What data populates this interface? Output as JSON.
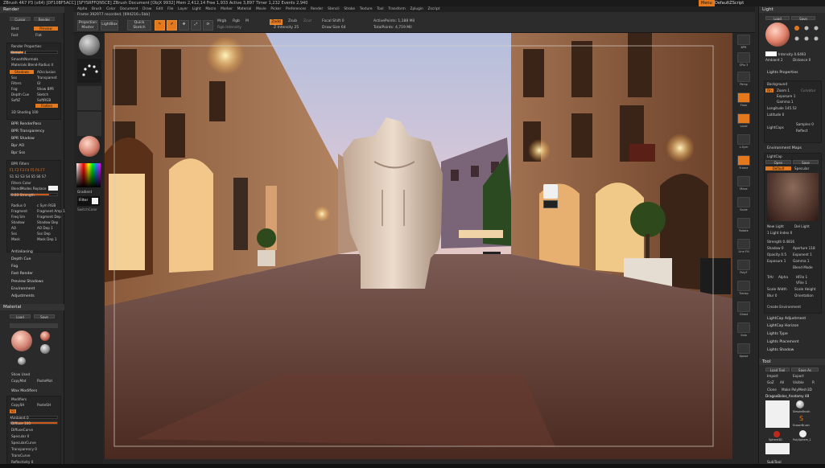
{
  "title_bar": {
    "app_info": "ZBrush 4R7 P3 (x64) [DF10BF5ACC] [SFYSRFFQN5CE]    ZBrush Document    [ObjX 9932] Mem 2,412,14  Free 1,933  Active 3,897  Timer 1,232  Events 2,940",
    "menu_label": "Menu",
    "script_label": "DefaultZScript"
  },
  "menubar": [
    "Alpha",
    "Brush",
    "Color",
    "Document",
    "Draw",
    "Edit",
    "File",
    "Layer",
    "Light",
    "Macro",
    "Marker",
    "Material",
    "Movie",
    "Picker",
    "Preferences",
    "Render",
    "Stencil",
    "Stroke",
    "Texture",
    "Tool",
    "Transform",
    "Zplugin",
    "Zscript"
  ],
  "toolbar": {
    "frame_info": "Frame 392977 recorded. [694216=5bb]",
    "projection_master": "Projection Master",
    "lightbox": "LightBox",
    "quick_sketch": "Quick Sketch",
    "edit": "Edit",
    "draw": "Draw",
    "move": "Move",
    "scale": "Scale",
    "rotate": "Rotate",
    "mrgb": "Mrgb",
    "rgb": "Rgb",
    "m": "M",
    "zadd": "Zadd",
    "zsub": "Zsub",
    "zcut": "Zcut",
    "rgb_intensity": "Rgb Intensity",
    "z_intensity": "Z Intensity 25",
    "focal_shift": "Focal Shift 0",
    "draw_size": "Draw Size 64",
    "active_points": "ActivePoints: 1,188 Mil",
    "total_points": "TotalPoints: 4,719 Mil"
  },
  "left_panel": {
    "render_title": "Render",
    "cursor": "Cursor",
    "render_btn": "Render",
    "best": "Best",
    "preview": "Preview",
    "fast": "Fast",
    "flat": "Flat",
    "render_properties": "Render Properties",
    "details": "Details 4",
    "smooth_normals": "SmoothNormals",
    "materials_blend_radius": "Materials Blend-Radius 4",
    "shadows": "Shadows",
    "ambient_occlusion": "AOcclusion",
    "sss": "Sss",
    "transparent": "Transparent",
    "gi": "GI",
    "bpr_filters_lbl": "Filters",
    "sketch": "Sketch",
    "fog": "Fog",
    "show_bpr": "Show BPR",
    "depth_cue": "Depth Cue",
    "softz": "SoftZ",
    "softrgb": "SoftRGB",
    "flatten": "Flatten",
    "ss_shading": "3D Shading 100",
    "bpr_renderpass": "BPR RenderPass",
    "bpr_transparency": "BPR Transparency",
    "bpr_shadow": "BPR Shadow",
    "bpr_ao": "Bpr AO",
    "bpr_sss": "Bpr Sss",
    "bpr_filters": "BPR Filters",
    "filter_color": "Filters Color",
    "blend_modes": "BlendModes Replace",
    "strength": "0.83  Strength",
    "radius": "Radius 0",
    "c_sym": "c Sym RGB",
    "fragment": "Fragment",
    "fragment_amp": "Fragment Amp 1",
    "freq_sm": "Freq Sm",
    "fragment_dep": "Fragment Dep",
    "shadow": "Shadow",
    "shadow_dep": "Shadow Dep",
    "ao": "AO",
    "ao_dep": "AO Dep 1",
    "sss2": "Sss",
    "sss_dep": "Sss Dep",
    "mask": "Mask",
    "mask_dep": "Mask Dep 1",
    "antialiasing": "Antialiasing",
    "depth_cue2": "Depth Cue",
    "fog2": "Fog",
    "fast_render": "Fast Render",
    "preview_shadows": "Preview Shadows",
    "environment": "Environment",
    "adjustments": "Adjustments",
    "material_title": "Material",
    "load": "Load",
    "save": "Save",
    "show_used": "Show Used",
    "copymat": "CopyMat",
    "pastemat": "PasteMat",
    "wax_modifiers": "Wax Modifiers",
    "modifiers": "Modifiers",
    "copysh": "CopySH",
    "pastesh": "PasteSH",
    "ambient": "Ambient 0",
    "diffuse": "Diffuse 100",
    "diffuse_curve": "DiffuseCurve",
    "specular": "Specular 0",
    "specular_curve": "SpecularCurve",
    "transparency": "Transparency 0",
    "transcurve": "TransCurve",
    "reflectivity": "Reflectivity 0",
    "colorize_diffuse": "ColorizeDiffuse",
    "colorize_specular": "ColorizeSpecular",
    "gradient": "Gradient",
    "switch_color": "SwitchColor"
  },
  "tray": {
    "filter": "Filter",
    "gradient": "Gradient",
    "switch_color": "SwitchColor"
  },
  "dock": [
    "BPR",
    "SPix 3",
    "Persp",
    "Floor",
    "Local",
    "L.Sym",
    "Frame",
    "Move",
    "Scale",
    "Rotate",
    "Line Fill",
    "PolyF",
    "Transp",
    "Ghost",
    "Solo",
    "Xpose"
  ],
  "right_panel": {
    "light_title": "Light",
    "load": "Load",
    "save": "Save",
    "intensity": "Intensity 0.6493",
    "ambient": "Ambient 2",
    "distance": "Distance 0",
    "lights_properties": "Lights Properties",
    "background": "Background",
    "on": "On",
    "zoom": "Zoom 1",
    "exposure": "Exposure 1",
    "gamma": "Gamma 1",
    "longitude": "Longitude 145.52",
    "latitude": "Latitude 0",
    "lightcaps": "LightCaps",
    "samples": "Samples 0",
    "reflect": "Reflect",
    "environment_maps": "Environment Maps",
    "lightcap": "LightCap",
    "open": "Open",
    "save2": "Save",
    "default": "Default",
    "specular": "Specular",
    "new_light": "New Light",
    "del_light": "Del Light",
    "light_index": "1 Light Index 0",
    "strength": "Strength 0.4816",
    "shadow": "Shadow 0",
    "aperture": "Aperture 118",
    "opacity": "Opacity 0.5",
    "exponent": "Exponent 1",
    "exposure2": "Exposure 1",
    "gamma2": "Gamma 1",
    "blend_mode": "Blend Mode",
    "tr": "TrAr",
    "alpha": "Alpha",
    "hfile": "HFile 1",
    "vfile": "VFile 1",
    "scale_width": "Scale Width",
    "scale_height": "Scale Height",
    "blur": "Blur 0",
    "orientation": "Orientation",
    "create_environment": "Create Environment",
    "lightcap_adjustment": "LightCap Adjustment",
    "lightcap_horizon": "LightCap Horizon",
    "lights_type": "Lights Type",
    "lights_placement": "Lights Placement",
    "lights_shadow": "Lights Shadow",
    "tool_title": "Tool",
    "load_tool": "Load Tool",
    "save_as": "Save As",
    "import": "Import",
    "export": "Export",
    "goz": "GoZ",
    "all": "All",
    "visible": "Visible",
    "r": "R",
    "clone": "Clone",
    "make_polymesh": "Make PolyMesh3D",
    "tool_name": "DragaoBolos_Anatomy 48",
    "simple_brush": "SimpleBrush",
    "eraser_brush": "EraserBrush",
    "sphere3d": "Sphere3D",
    "polysphere": "PolySphere_1",
    "subtool": "SubTool"
  },
  "colors": {
    "accent": "#e4781c",
    "panel": "#2a2a2a",
    "panel_dark": "#1e1e1e"
  }
}
